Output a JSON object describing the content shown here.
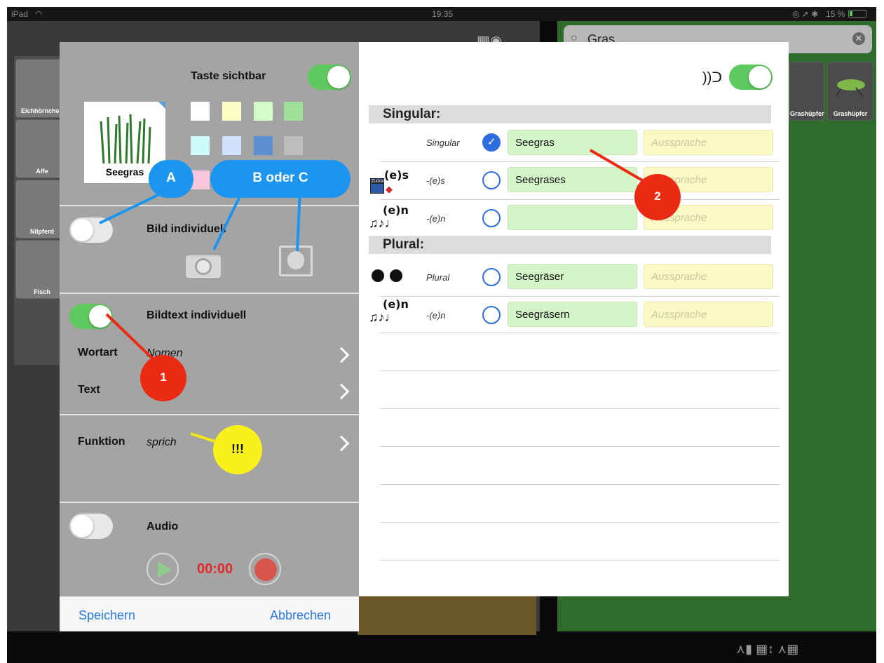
{
  "status": {
    "device": "iPad",
    "time": "19:35",
    "battery": "15 %"
  },
  "search": {
    "value": "Gras"
  },
  "background_tiles": [
    {
      "label": "Eichhörnchen"
    },
    {
      "label": "Affe"
    },
    {
      "label": "Nilpferd"
    },
    {
      "label": "Fisch"
    }
  ],
  "right_tiles": [
    {
      "label": "Grashüpfer"
    },
    {
      "label": "Grashüpfer"
    }
  ],
  "left_panel": {
    "taste_label": "Taste sichtbar",
    "preview_caption": "Seegras",
    "swatches": [
      "#ffffff",
      "#fdfdc6",
      "#d4fcc9",
      "#9fe09a",
      "#cdfafb",
      "#cfe0fd",
      "#5b8fd1",
      "#bdbdbd",
      "#f7c6da"
    ],
    "bild_label": "Bild individuell",
    "bildtext_label": "Bildtext individuell",
    "wortart_label": "Wortart",
    "wortart_value": "Nomen",
    "text_label": "Text",
    "funktion_label": "Funktion",
    "funktion_value": "sprich",
    "audio_label": "Audio",
    "audio_time": "00:00",
    "save": "Speichern",
    "cancel": "Abbrechen"
  },
  "right_panel": {
    "singular_header": "Singular:",
    "plural_header": "Plural:",
    "singular_rows": [
      {
        "suffix": "",
        "kind": "Singular",
        "value": "Seegras",
        "placeholder": "Aussprache",
        "selected": true
      },
      {
        "suffix": "(e)s",
        "kind": "-(e)s",
        "value": "Seegrases",
        "placeholder": "Aussprache",
        "selected": false
      },
      {
        "suffix": "(e)n",
        "kind": "-(e)n",
        "value": "",
        "placeholder": "Aussprache",
        "selected": false
      }
    ],
    "plural_rows": [
      {
        "suffix": "",
        "kind": "Plural",
        "value": "Seegräser",
        "placeholder": "Aussprache",
        "selected": false
      },
      {
        "suffix": "(e)n",
        "kind": "-(e)n",
        "value": "Seegräsern",
        "placeholder": "Aussprache",
        "selected": false
      }
    ],
    "zucker": "Zucker"
  },
  "annotations": {
    "a": "A",
    "b": "B oder C",
    "n1": "1",
    "n2": "2",
    "warn": "!!!"
  }
}
